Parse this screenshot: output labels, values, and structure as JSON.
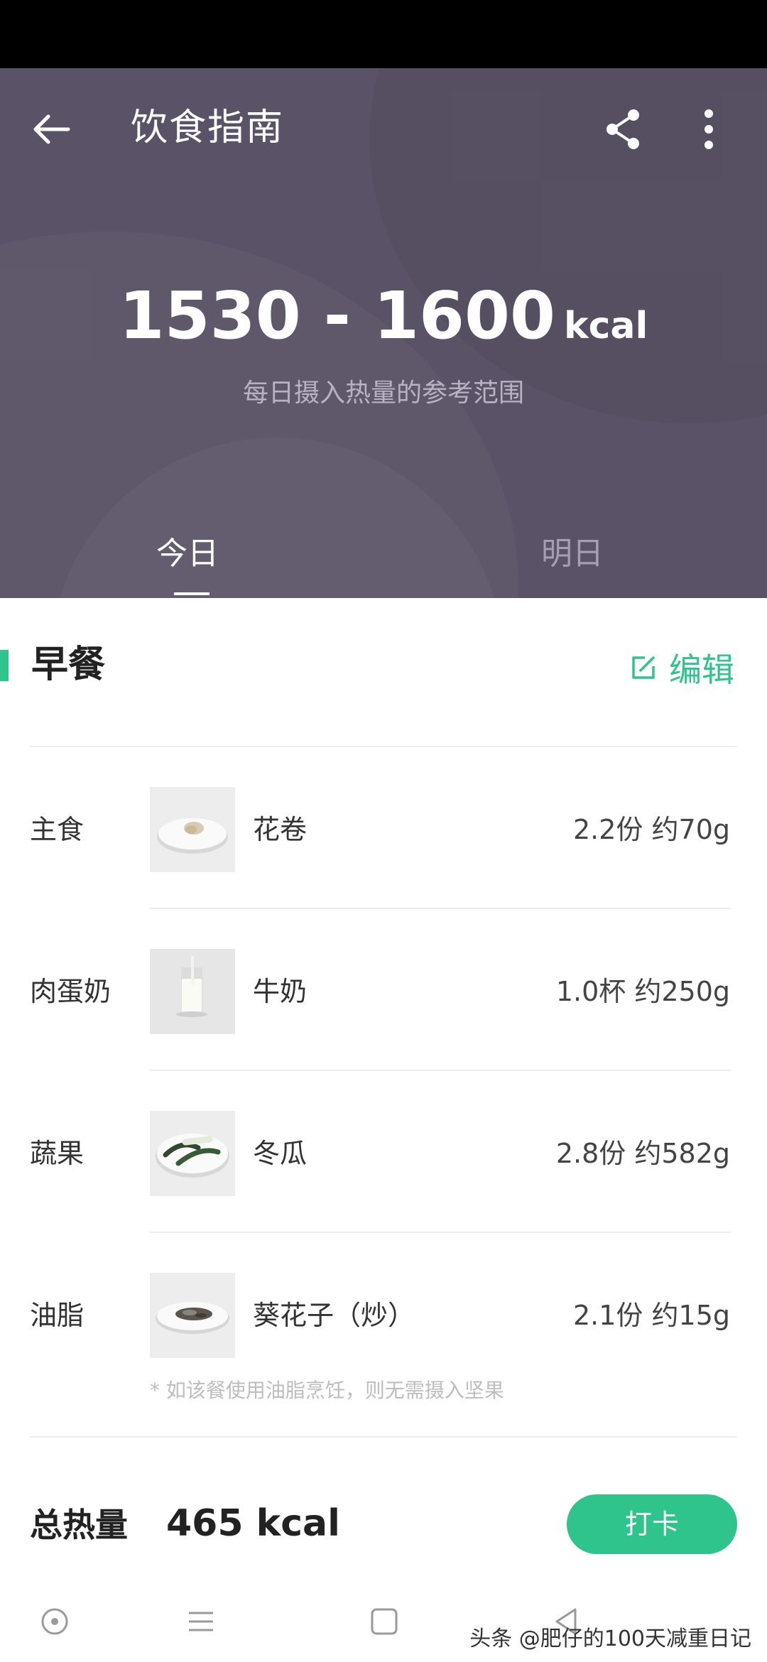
{
  "header": {
    "title": "饮食指南",
    "kcal_range": "1530 - 1600",
    "kcal_unit": "kcal",
    "kcal_caption": "每日摄入热量的参考范围",
    "tabs": [
      {
        "label": "今日",
        "active": true
      },
      {
        "label": "明日",
        "active": false
      }
    ]
  },
  "meal": {
    "title": "早餐",
    "edit_label": "编辑",
    "items": [
      {
        "category": "主食",
        "food": "花卷",
        "amount": "2.2份 约70g",
        "icon": "bun-plate"
      },
      {
        "category": "肉蛋奶",
        "food": "牛奶",
        "amount": "1.0杯 约250g",
        "icon": "milk-glass"
      },
      {
        "category": "蔬果",
        "food": "冬瓜",
        "amount": "2.8份 约582g",
        "icon": "wax-gourd-plate"
      },
      {
        "category": "油脂",
        "food": "葵花子（炒）",
        "amount": "2.1份 约15g",
        "icon": "sunflower-seeds-plate"
      }
    ],
    "note": "* 如该餐使用油脂烹饪，则无需摄入坚果",
    "total_label": "总热量",
    "total_value": "465 kcal",
    "checkin_label": "打卡"
  },
  "watermark": "头条 @肥仔的100天减重日记",
  "colors": {
    "header_bg": "#5a5266",
    "accent": "#2ec48c"
  }
}
